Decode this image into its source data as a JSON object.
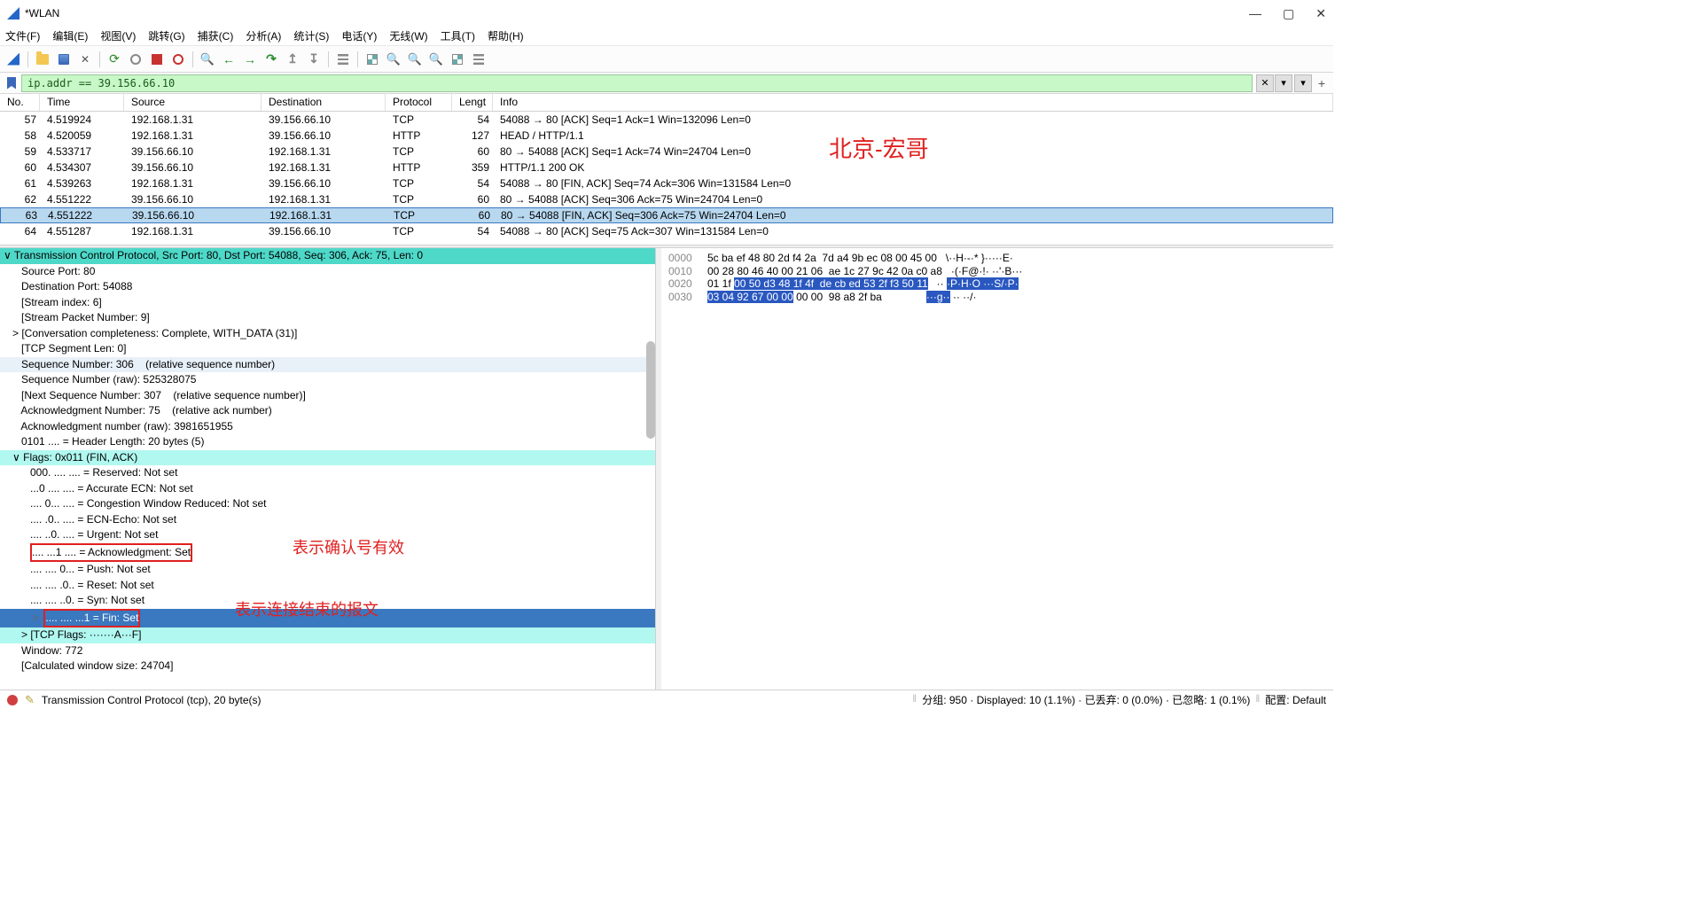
{
  "title": "*WLAN",
  "menu": [
    "文件(F)",
    "编辑(E)",
    "视图(V)",
    "跳转(G)",
    "捕获(C)",
    "分析(A)",
    "统计(S)",
    "电话(Y)",
    "无线(W)",
    "工具(T)",
    "帮助(H)"
  ],
  "filter": "ip.addr == 39.156.66.10",
  "columns": {
    "no": "No.",
    "time": "Time",
    "src": "Source",
    "dst": "Destination",
    "proto": "Protocol",
    "len": "Lengt",
    "info": "Info"
  },
  "watermark": "北京-宏哥",
  "packets": [
    {
      "no": "57",
      "time": "4.519924",
      "src": "192.168.1.31",
      "dst": "39.156.66.10",
      "proto": "TCP",
      "len": "54",
      "info": "54088 → 80 [ACK] Seq=1 Ack=1 Win=132096 Len=0"
    },
    {
      "no": "58",
      "time": "4.520059",
      "src": "192.168.1.31",
      "dst": "39.156.66.10",
      "proto": "HTTP",
      "len": "127",
      "info": "HEAD / HTTP/1.1"
    },
    {
      "no": "59",
      "time": "4.533717",
      "src": "39.156.66.10",
      "dst": "192.168.1.31",
      "proto": "TCP",
      "len": "60",
      "info": "80 → 54088 [ACK] Seq=1 Ack=74 Win=24704 Len=0"
    },
    {
      "no": "60",
      "time": "4.534307",
      "src": "39.156.66.10",
      "dst": "192.168.1.31",
      "proto": "HTTP",
      "len": "359",
      "info": "HTTP/1.1 200 OK"
    },
    {
      "no": "61",
      "time": "4.539263",
      "src": "192.168.1.31",
      "dst": "39.156.66.10",
      "proto": "TCP",
      "len": "54",
      "info": "54088 → 80 [FIN, ACK] Seq=74 Ack=306 Win=131584 Len=0"
    },
    {
      "no": "62",
      "time": "4.551222",
      "src": "39.156.66.10",
      "dst": "192.168.1.31",
      "proto": "TCP",
      "len": "60",
      "info": "80 → 54088 [ACK] Seq=306 Ack=75 Win=24704 Len=0"
    },
    {
      "no": "63",
      "time": "4.551222",
      "src": "39.156.66.10",
      "dst": "192.168.1.31",
      "proto": "TCP",
      "len": "60",
      "info": "80 → 54088 [FIN, ACK] Seq=306 Ack=75 Win=24704 Len=0",
      "sel": true
    },
    {
      "no": "64",
      "time": "4.551287",
      "src": "192.168.1.31",
      "dst": "39.156.66.10",
      "proto": "TCP",
      "len": "54",
      "info": "54088 → 80 [ACK] Seq=75 Ack=307 Win=131584 Len=0"
    }
  ],
  "details": [
    {
      "t": "∨ Transmission Control Protocol, Src Port: 80, Dst Port: 54088, Seq: 306, Ack: 75, Len: 0",
      "cls": "det-hl-teal",
      "i": 0
    },
    {
      "t": "Source Port: 80",
      "i": 2
    },
    {
      "t": "Destination Port: 54088",
      "i": 2
    },
    {
      "t": "[Stream index: 6]",
      "i": 2
    },
    {
      "t": "[Stream Packet Number: 9]",
      "i": 2
    },
    {
      "t": "> [Conversation completeness: Complete, WITH_DATA (31)]",
      "i": 1
    },
    {
      "t": "[TCP Segment Len: 0]",
      "i": 2
    },
    {
      "t": "Sequence Number: 306    (relative sequence number)",
      "cls": "det-hl-sel",
      "i": 2
    },
    {
      "t": "Sequence Number (raw): 525328075",
      "i": 2
    },
    {
      "t": "[Next Sequence Number: 307    (relative sequence number)]",
      "i": 2
    },
    {
      "t": "Acknowledgment Number: 75    (relative ack number)",
      "i": 2
    },
    {
      "t": "Acknowledgment number (raw): 3981651955",
      "i": 2
    },
    {
      "t": "0101 .... = Header Length: 20 bytes (5)",
      "i": 2
    },
    {
      "t": "∨ Flags: 0x011 (FIN, ACK)",
      "cls": "det-hl-cyan",
      "i": 1
    },
    {
      "t": "000. .... .... = Reserved: Not set",
      "i": 3
    },
    {
      "t": "...0 .... .... = Accurate ECN: Not set",
      "i": 3
    },
    {
      "t": ".... 0... .... = Congestion Window Reduced: Not set",
      "i": 3
    },
    {
      "t": ".... .0.. .... = ECN-Echo: Not set",
      "i": 3
    },
    {
      "t": ".... ..0. .... = Urgent: Not set",
      "i": 3
    },
    {
      "t": ".... ...1 .... = Acknowledgment: Set",
      "i": 3,
      "box": true
    },
    {
      "t": ".... .... 0... = Push: Not set",
      "i": 3
    },
    {
      "t": ".... .... .0.. = Reset: Not set",
      "i": 3
    },
    {
      "t": ".... .... ..0. = Syn: Not set",
      "i": 3
    },
    {
      "t": ".... .... ...1 = Fin: Set",
      "cls": "det-hl-blue",
      "i": 3,
      "box": true,
      "caret": ">"
    },
    {
      "t": "> [TCP Flags: ·······A···F]",
      "cls": "det-hl-cyan",
      "i": 2
    },
    {
      "t": "Window: 772",
      "i": 2
    },
    {
      "t": "[Calculated window size: 24704]",
      "i": 2
    }
  ],
  "anno1": "表示确认号有效",
  "anno2": "表示连接结束的报文",
  "hex": {
    "rows": [
      {
        "off": "0000",
        "b": "5c ba ef 48 80 2d f4 2a  7d a4 9b ec 08 00 45 00",
        "a": "\\··H·-·* }·····E·"
      },
      {
        "off": "0010",
        "b": "00 28 80 46 40 00 21 06  ae 1c 27 9c 42 0a c0 a8",
        "a": "·(·F@·!· ··'·B···"
      },
      {
        "off": "0020",
        "b1": "01 1f ",
        "b2": "00 50 d3 48 1f 4f  de cb ed 53 2f f3 50 11",
        "a1": "·· ",
        "a2": "·P·H·O ···S/·P·"
      },
      {
        "off": "0030",
        "b1": "03 04 92 67 00 00",
        "b2": " 00 00  98 a8 2f ba",
        "a1": "···g··",
        "a2": " ·· ··/·"
      }
    ]
  },
  "status": {
    "main": "Transmission Control Protocol (tcp), 20 byte(s)",
    "right": "分组: 950 · Displayed: 10 (1.1%) · 已丢弃: 0 (0.0%) · 已忽略: 1 (0.1%)",
    "profile": "配置: Default"
  }
}
